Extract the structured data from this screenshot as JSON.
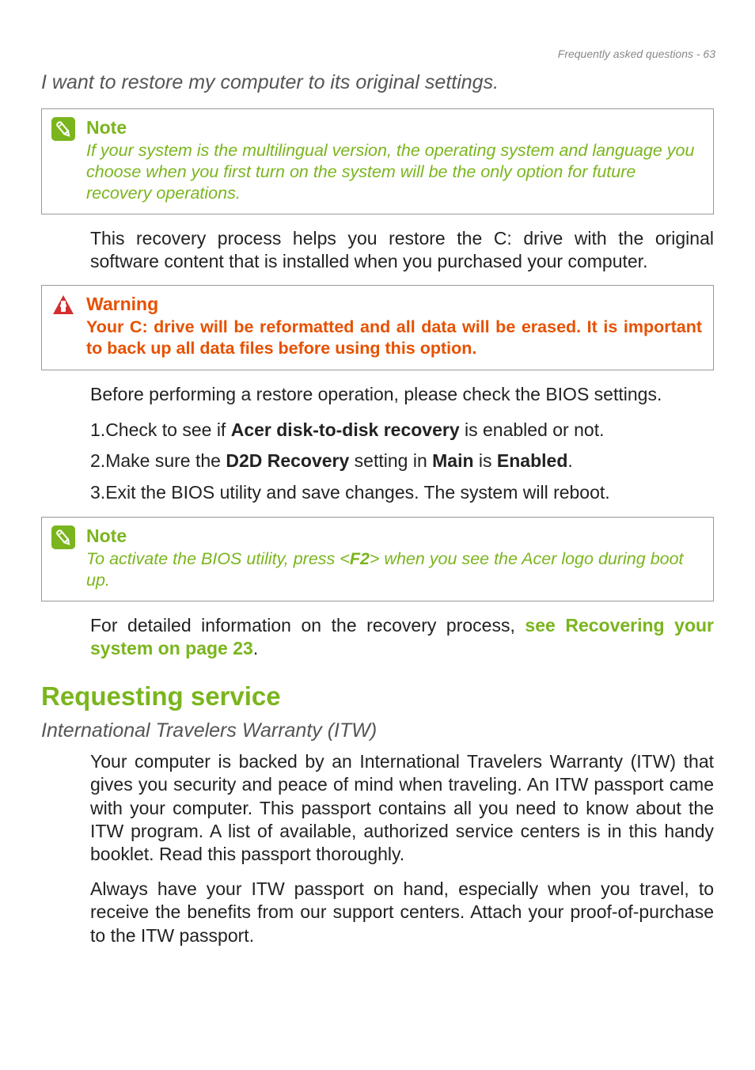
{
  "pageHeader": "Frequently asked questions - 63",
  "questionHeading": "I want to restore my computer to its original settings.",
  "note1": {
    "title": "Note",
    "body": "If your system is the multilingual version, the operating system and language you choose when you first turn on the system will be the only option for future recovery operations."
  },
  "para1": "This recovery process helps you restore the C: drive with the original software content that is installed when you purchased your computer.",
  "warning": {
    "title": "Warning",
    "body": "Your C: drive will be reformatted and all data will be erased. It is important to back up all data files before using this option."
  },
  "para2": "Before performing a restore operation, please check the BIOS settings.",
  "list": {
    "item1": {
      "num": "1",
      "pre": "Check to see if ",
      "bold": "Acer disk-to-disk recovery",
      "post": " is enabled or not."
    },
    "item2": {
      "num": "2",
      "pre": "Make sure the ",
      "bold1": "D2D Recovery",
      "mid": " setting in ",
      "bold2": "Main",
      "mid2": " is ",
      "bold3": "Enabled",
      "post": "."
    },
    "item3": {
      "num": "3",
      "text": "Exit the BIOS utility and save changes. The system will reboot."
    }
  },
  "note2": {
    "title": "Note",
    "body_pre": "To activate the BIOS utility, press <",
    "body_key": "F2",
    "body_post": "> when you see the Acer logo during boot up."
  },
  "para3": {
    "pre": "For detailed information on the recovery process, ",
    "link": "see Recovering your system on page 23",
    "post": "."
  },
  "sectionHeading": "Requesting service",
  "itwHeading": "International Travelers Warranty (ITW)",
  "itwPara1": "Your computer is backed by an International Travelers Warranty (ITW) that gives you security and peace of mind when traveling. An ITW passport came with your computer. This passport contains all you need to know about the ITW program. A list of available, authorized service centers is in this handy booklet. Read this passport thoroughly.",
  "itwPara2": "Always have your ITW passport on hand, especially when you travel, to receive the benefits from our support centers. Attach your proof-of-purchase to the ITW passport."
}
